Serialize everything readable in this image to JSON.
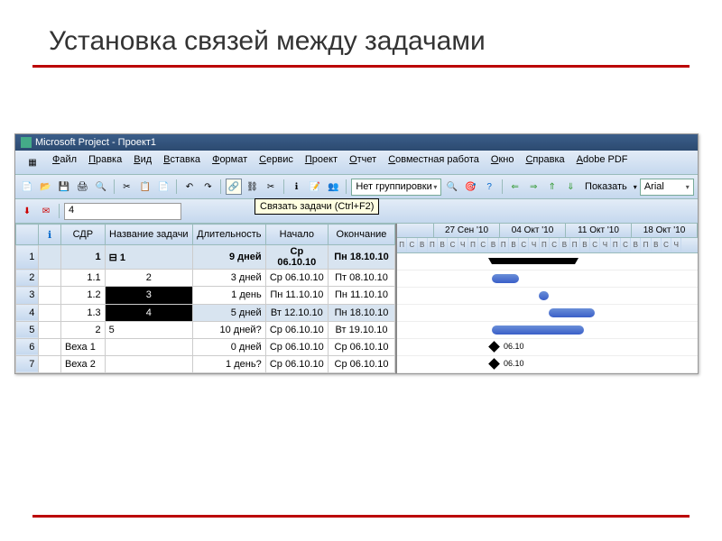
{
  "slide_title": "Установка связей между задачами",
  "app_title": "Microsoft Project - Проект1",
  "menu": [
    "Файл",
    "Правка",
    "Вид",
    "Вставка",
    "Формат",
    "Сервис",
    "Проект",
    "Отчет",
    "Совместная работа",
    "Окно",
    "Справка",
    "Adobe PDF"
  ],
  "tooltip": "Связать задачи (Ctrl+F2)",
  "combo_group": "Нет группировки",
  "btn_show": "Показать",
  "font_name": "Arial",
  "formula_val": "4",
  "columns": {
    "info": "",
    "sdr": "СДР",
    "name": "Название задачи",
    "dur": "Длительность",
    "start": "Начало",
    "end": "Окончание"
  },
  "info_icon_hdr": "ℹ",
  "bold1": "1",
  "outline1": "⊟ 1",
  "rows": [
    {
      "n": "1",
      "sdr": "1",
      "name": "⊟ 1",
      "dur": "9 дней",
      "start": "Ср 06.10.10",
      "end": "Пн 18.10.10",
      "hl": true,
      "bold": true
    },
    {
      "n": "2",
      "sdr": "1.1",
      "name": "2",
      "dur": "3 дней",
      "start": "Ср 06.10.10",
      "end": "Пт 08.10.10"
    },
    {
      "n": "3",
      "sdr": "1.2",
      "name": "3",
      "dur": "1 день",
      "start": "Пн 11.10.10",
      "end": "Пн 11.10.10",
      "sel": true
    },
    {
      "n": "4",
      "sdr": "1.3",
      "name": "4",
      "dur": "5 дней",
      "start": "Вт 12.10.10",
      "end": "Пн 18.10.10",
      "sel": true,
      "hl": true
    },
    {
      "n": "5",
      "sdr": "2",
      "name": "5",
      "dur": "10 дней?",
      "start": "Ср 06.10.10",
      "end": "Вт 19.10.10"
    },
    {
      "n": "6",
      "sdr": "Веха 1",
      "name": "",
      "dur": "0 дней",
      "start": "Ср 06.10.10",
      "end": "Ср 06.10.10"
    },
    {
      "n": "7",
      "sdr": "Веха 2",
      "name": "",
      "dur": "1 день?",
      "start": "Ср 06.10.10",
      "end": "Ср 06.10.10"
    }
  ],
  "weeks": [
    "27 Сен '10",
    "04 Окт '10",
    "11 Окт '10",
    "18 Окт '10"
  ],
  "day_letters": [
    "П",
    "С",
    "В",
    "П",
    "В",
    "С",
    "Ч",
    "П",
    "С",
    "В",
    "П",
    "В",
    "С",
    "Ч",
    "П",
    "С",
    "В",
    "П",
    "В",
    "С",
    "Ч",
    "П",
    "С",
    "В",
    "П",
    "В",
    "С",
    "Ч"
  ],
  "ms_label": "06.10",
  "chart_data": {
    "type": "gantt",
    "date_range": [
      "27.09.10",
      "20.10.10"
    ],
    "tasks": [
      {
        "id": 1,
        "name": "1",
        "type": "summary",
        "start": "06.10.10",
        "end": "18.10.10"
      },
      {
        "id": 2,
        "name": "2",
        "type": "task",
        "start": "06.10.10",
        "end": "08.10.10"
      },
      {
        "id": 3,
        "name": "3",
        "type": "task",
        "start": "11.10.10",
        "end": "11.10.10"
      },
      {
        "id": 4,
        "name": "4",
        "type": "task",
        "start": "12.10.10",
        "end": "18.10.10"
      },
      {
        "id": 5,
        "name": "5",
        "type": "task",
        "start": "06.10.10",
        "end": "19.10.10"
      },
      {
        "id": 6,
        "name": "Веха 1",
        "type": "milestone",
        "date": "06.10.10",
        "label": "06.10"
      },
      {
        "id": 7,
        "name": "Веха 2",
        "type": "milestone",
        "date": "06.10.10",
        "label": "06.10"
      }
    ],
    "links": [
      {
        "from": 2,
        "to": 3
      },
      {
        "from": 3,
        "to": 4
      }
    ]
  }
}
